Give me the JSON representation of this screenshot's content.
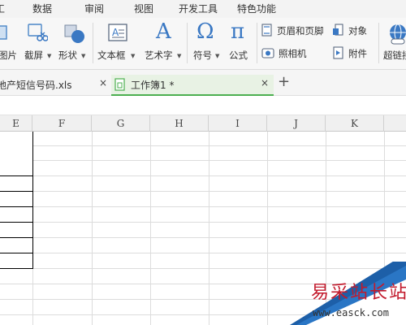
{
  "menu": {
    "items": [
      "工",
      "数据",
      "审阅",
      "视图",
      "开发工具",
      "特色功能"
    ]
  },
  "ribbon": {
    "picture_label": "图片",
    "screenshot_label": "截屏",
    "shapes_label": "形状",
    "textbox_label": "文本框",
    "wordart_label": "艺术字",
    "symbol_label": "符号",
    "formula_label": "公式",
    "header_footer_label": "页眉和页脚",
    "object_label": "对象",
    "camera_label": "照相机",
    "attachment_label": "附件",
    "hyperlink_label": "超链接",
    "wordart_glyph": "A",
    "symbol_glyph": "Ω",
    "formula_glyph": "π"
  },
  "tabs": [
    {
      "label": "地产短信号码.xls",
      "active": false
    },
    {
      "label": "工作簿1 *",
      "active": true
    }
  ],
  "new_tab_label": "+",
  "close_glyph": "×",
  "sheet": {
    "columns": [
      "E",
      "F",
      "G",
      "H",
      "I",
      "J",
      "K"
    ]
  },
  "watermark": {
    "title": "易采站长站",
    "url": "www.easck.com"
  },
  "colors": {
    "active_tab_underline": "#4caf50",
    "active_tab_bg": "#e8f2e4",
    "icon_blue": "#3a78c3"
  }
}
